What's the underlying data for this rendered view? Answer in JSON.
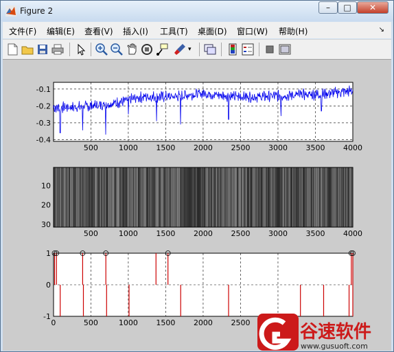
{
  "window": {
    "title": "Figure 2"
  },
  "menu": [
    "文件(F)",
    "编辑(E)",
    "查看(V)",
    "插入(I)",
    "工具(T)",
    "桌面(D)",
    "窗口(W)",
    "帮助(H)"
  ],
  "toolbar_icons": [
    "new-figure-icon",
    "open-file-icon",
    "save-icon",
    "print-icon",
    "edit-plot-arrow-icon",
    "zoom-in-icon",
    "zoom-out-icon",
    "pan-hand-icon",
    "rotate-3d-icon",
    "data-cursor-icon",
    "brush-icon",
    "brush-dropdown-icon",
    "link-plot-icon",
    "colorbar-icon",
    "legend-icon",
    "hide-plot-tools-icon",
    "show-plot-tools-icon"
  ],
  "watermark": {
    "brand_cn": "谷速软件",
    "url": "www.gusuoft.com"
  },
  "chart_data": [
    {
      "type": "line",
      "x_range": [
        1,
        4000
      ],
      "xlim": [
        1,
        4000
      ],
      "ylim": [
        -0.41,
        -0.06
      ],
      "xticks": [
        500,
        1000,
        1500,
        2000,
        2500,
        3000,
        3500,
        4000
      ],
      "yticks": [
        -0.1,
        -0.2,
        -0.3,
        -0.4
      ],
      "ytick_labels": [
        "-0.1",
        "-0.2",
        "-0.3",
        "-0.4"
      ],
      "grid": true,
      "color": "#0000ee",
      "series": [
        {
          "name": "",
          "trend_x": [
            1,
            400,
            800,
            1200,
            1600,
            2000,
            2400,
            2800,
            3200,
            3600,
            4000
          ],
          "trend_y": [
            -0.21,
            -0.205,
            -0.185,
            -0.145,
            -0.145,
            -0.125,
            -0.145,
            -0.145,
            -0.135,
            -0.13,
            -0.11
          ],
          "dips_x": [
            90,
            390,
            700,
            1000,
            1380,
            1700,
            2340,
            3040,
            3580
          ],
          "dips_y": [
            -0.36,
            -0.345,
            -0.37,
            -0.25,
            -0.29,
            -0.31,
            -0.28,
            -0.26,
            -0.23
          ]
        }
      ]
    },
    {
      "type": "heatmap",
      "xlim": [
        1,
        4000
      ],
      "ylim": [
        1,
        31
      ],
      "y_reversed": true,
      "xticks": [
        500,
        1000,
        1500,
        2000,
        2500,
        3000,
        3500,
        4000
      ],
      "yticks": [
        10,
        20,
        30
      ],
      "colormap": "gray",
      "description": "dense alternating dark/light vertical striping across full width"
    },
    {
      "type": "stem",
      "xlim": [
        1,
        4000
      ],
      "ylim": [
        -1,
        1
      ],
      "xticks": [
        0,
        500,
        1000,
        1500,
        2000,
        2500,
        3000
      ],
      "yticks": [
        1,
        0,
        -1
      ],
      "grid": true,
      "color": "#cc0000",
      "positive_spikes_x": [
        15,
        40,
        390,
        700,
        1370,
        1530,
        3980,
        4000
      ],
      "positive_spikes_y": [
        1,
        1,
        1,
        1,
        1,
        1,
        1,
        1
      ],
      "marked_positive_x": [
        15,
        40,
        390,
        700,
        1530,
        3980,
        4000
      ],
      "negative_spikes_x": [
        90,
        400,
        710,
        1010,
        1700,
        2340,
        3300,
        3610,
        3950,
        4000
      ],
      "negative_spikes_y": [
        -1,
        -1,
        -1,
        -1,
        -1,
        -1,
        -1,
        -1,
        -1,
        -1
      ]
    }
  ]
}
